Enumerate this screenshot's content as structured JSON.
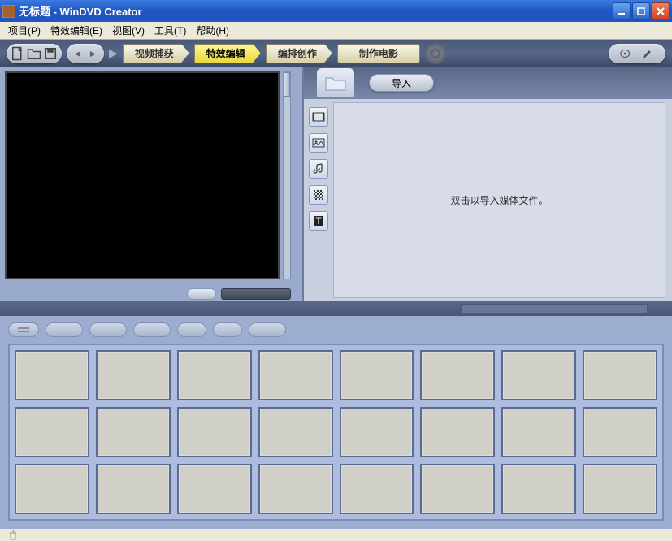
{
  "window": {
    "title": "无标题 - WinDVD Creator"
  },
  "menu": {
    "project": "项目(P)",
    "effects": "特效编辑(E)",
    "view": "视图(V)",
    "tools": "工具(T)",
    "help": "帮助(H)"
  },
  "steps": {
    "capture": "视频捕获",
    "edit": "特效编辑",
    "author": "编排创作",
    "make": "制作电影"
  },
  "import": {
    "label": "导入"
  },
  "media": {
    "hint": "双击以导入媒体文件。"
  },
  "icons": {
    "new": "new-file",
    "open": "open-file",
    "save": "save-file",
    "undo": "undo",
    "redo": "redo",
    "folder": "folder",
    "video": "video-clip",
    "image": "image",
    "audio": "audio-note",
    "effect": "effect-pattern",
    "text": "text-title",
    "trash": "trash"
  }
}
